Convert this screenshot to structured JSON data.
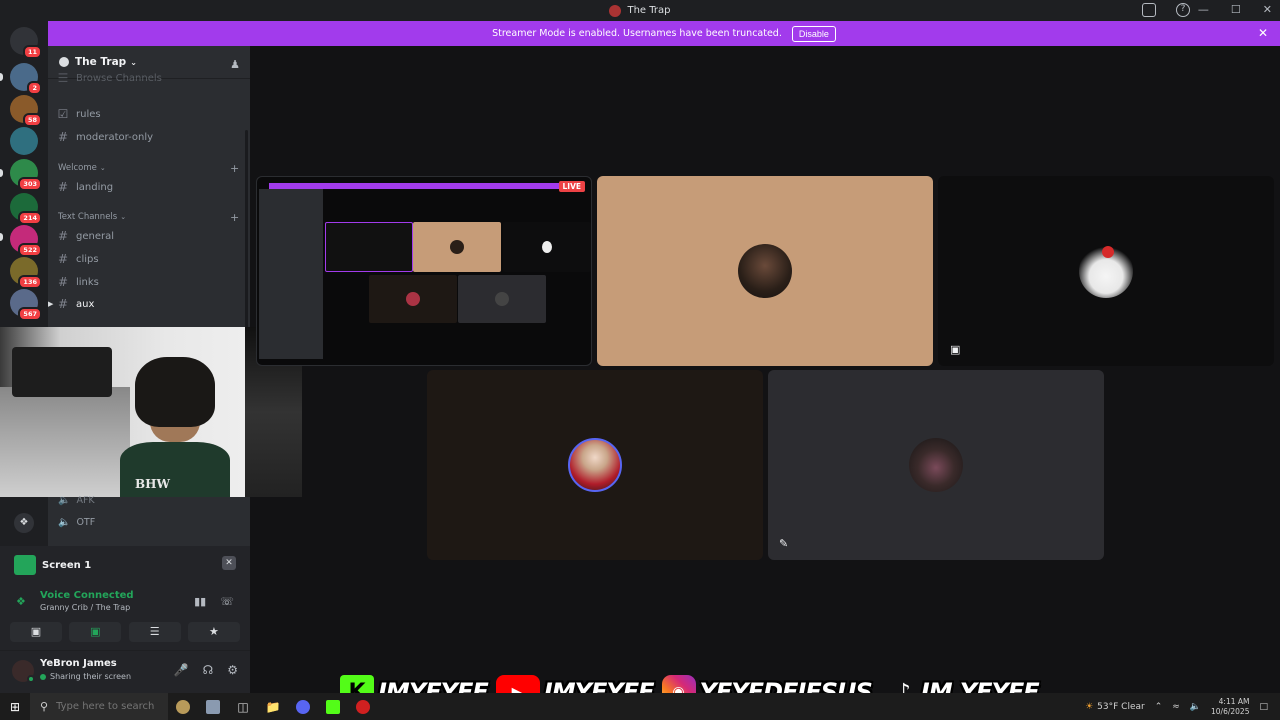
{
  "window": {
    "title": "The Trap"
  },
  "banner": {
    "message": "Streamer Mode is enabled. Usernames have been truncated.",
    "disable_label": "Disable"
  },
  "server_rail": {
    "badges": [
      "11",
      "2",
      "58",
      "303",
      "214",
      "522",
      "136",
      "567"
    ]
  },
  "server": {
    "name": "The Trap"
  },
  "channels": {
    "partial_top": "Browse Channels",
    "top": [
      {
        "label": "rules",
        "icon": "rules-icon"
      },
      {
        "label": "moderator-only",
        "icon": "hash-icon"
      }
    ],
    "categories": [
      {
        "label": "Welcome",
        "channels": [
          {
            "label": "landing"
          }
        ]
      },
      {
        "label": "Text Channels",
        "channels": [
          {
            "label": "general"
          },
          {
            "label": "clips"
          },
          {
            "label": "links"
          },
          {
            "label": "aux"
          }
        ]
      }
    ],
    "voice": [
      {
        "label": "AFK"
      },
      {
        "label": "OTF"
      }
    ]
  },
  "webcam": {
    "shirt_text": "BHW"
  },
  "screen_share": {
    "label": "Screen 1"
  },
  "voice_panel": {
    "status": "Voice Connected",
    "location": "Granny Crib / The Trap"
  },
  "user": {
    "name": "YeBron James",
    "status": "Sharing their screen"
  },
  "stage": {
    "live_label": "LIVE"
  },
  "socials": {
    "kick": "IMYEYEE",
    "youtube": "IMYEYEE",
    "instagram": "YEYEDEJESUS_",
    "tiktok": "IM.YEYEE"
  },
  "taskbar": {
    "search_placeholder": "Type here to search",
    "weather": "53°F  Clear",
    "time": "4:11 AM",
    "date": "10/6/2025"
  },
  "colors": {
    "accent_purple": "#a23bec",
    "online_green": "#23a55a",
    "live_red": "#ed4245"
  }
}
